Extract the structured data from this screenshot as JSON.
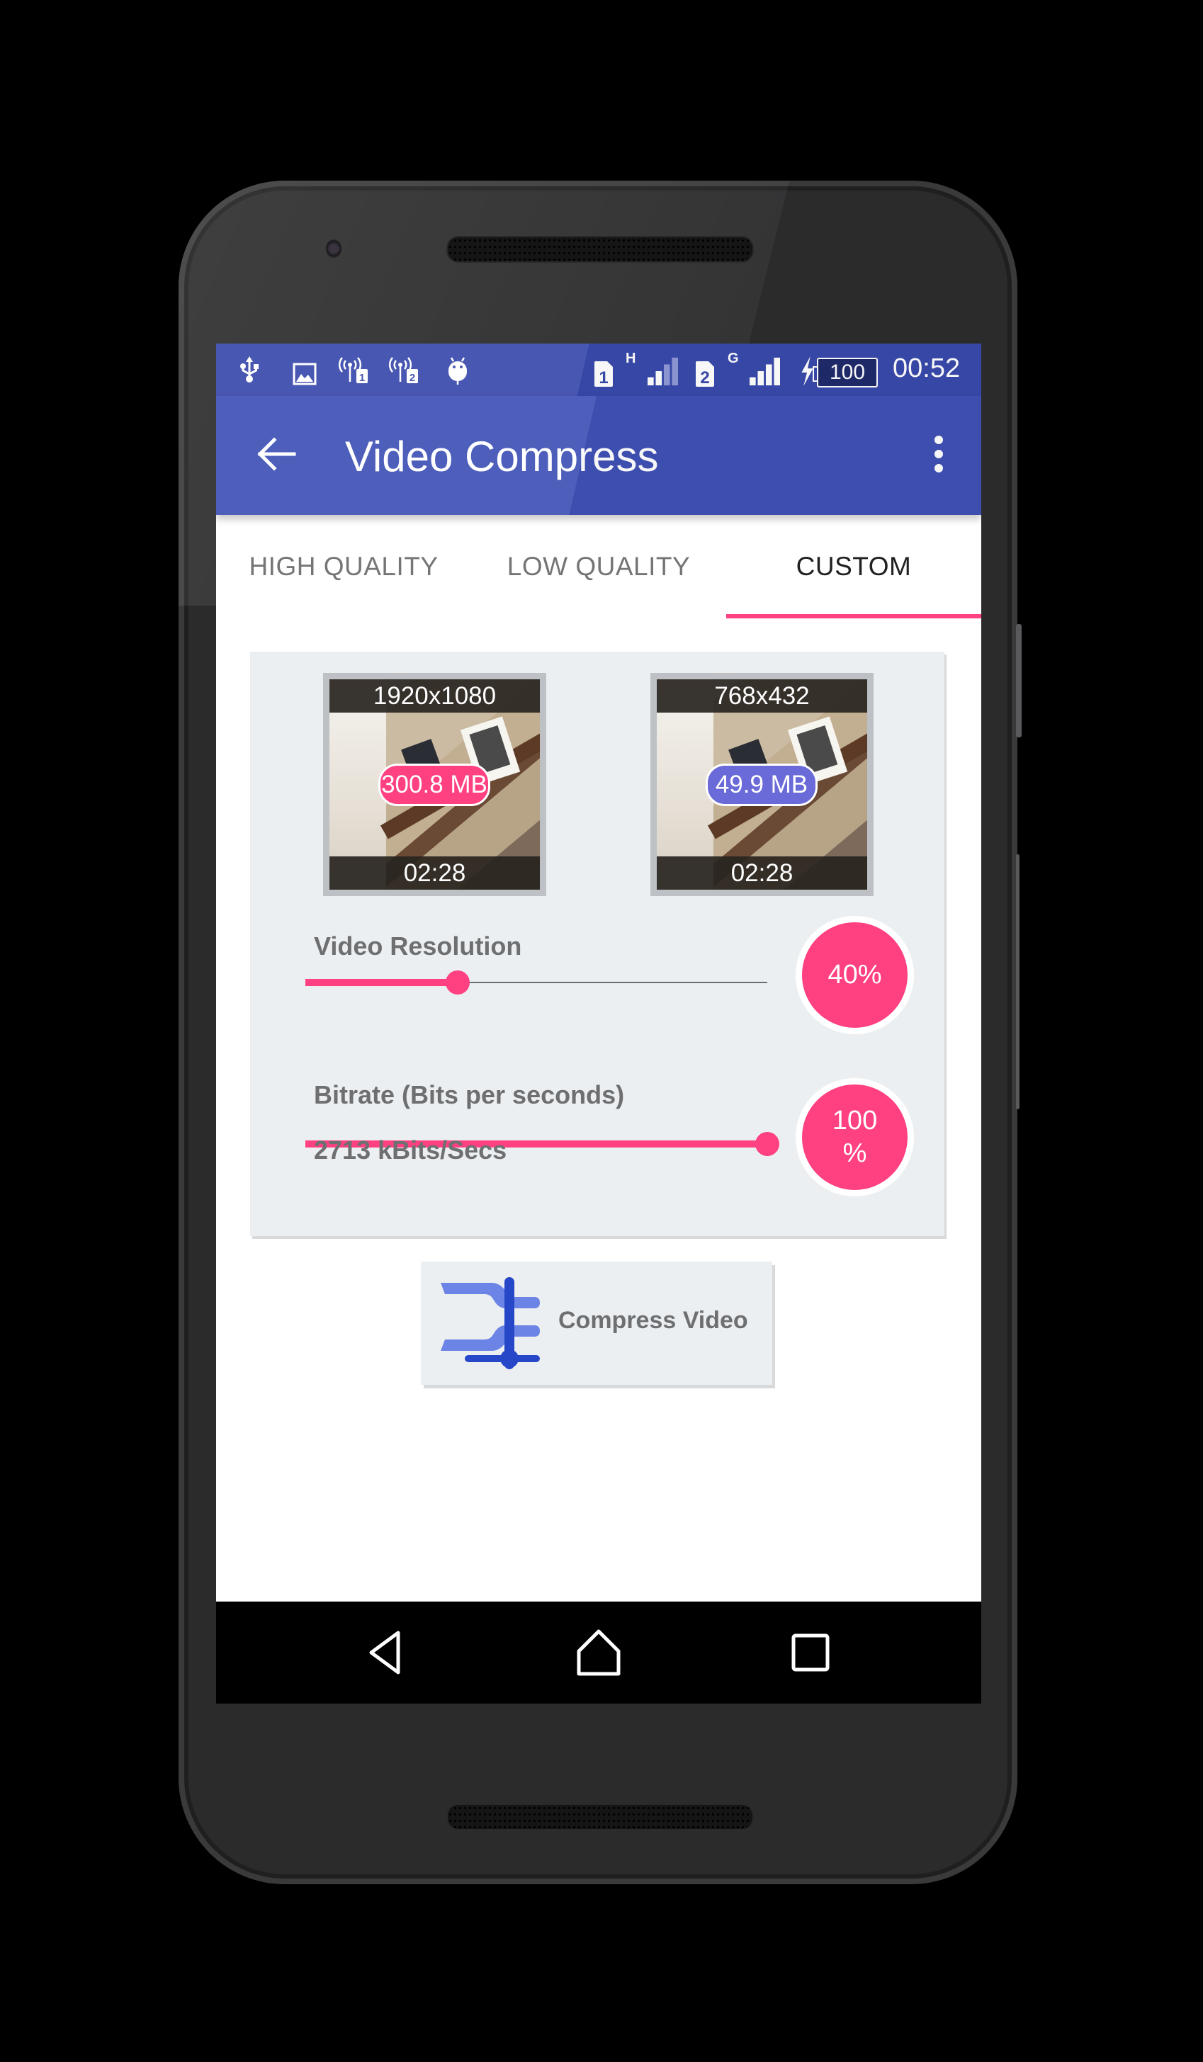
{
  "status_bar": {
    "left_icons": [
      "usb-icon",
      "image-icon",
      "hotspot-sim1-icon",
      "hotspot-sim2-icon",
      "android-debug-icon"
    ],
    "sim1": {
      "label": "1",
      "network": "H",
      "signal_bars": 2,
      "signal_max": 4
    },
    "sim2": {
      "label": "2",
      "network": "G",
      "signal_bars": 4,
      "signal_max": 4
    },
    "charging": true,
    "battery": "100",
    "time": "00:52"
  },
  "toolbar": {
    "title": "Video Compress",
    "back_icon": "arrow-left-icon",
    "menu_icon": "more-vertical-icon"
  },
  "tabs": [
    {
      "label": "HIGH QUALITY",
      "active": false
    },
    {
      "label": "LOW QUALITY",
      "active": false
    },
    {
      "label": "CUSTOM",
      "active": true
    }
  ],
  "colors": {
    "primary": "#3f51b5",
    "primary_dark": "#3949ab",
    "accent": "#ff4081",
    "output_badge": "#6a6ad8",
    "card_bg": "#eceff1"
  },
  "original_video": {
    "resolution": "1920x1080",
    "size": "300.8 MB",
    "duration": "02:28"
  },
  "output_video": {
    "resolution": "768x432",
    "size": "49.9 MB",
    "duration": "02:28"
  },
  "video_resolution": {
    "label": "Video Resolution",
    "value_percent": 40,
    "display": "40%"
  },
  "bitrate": {
    "label": "Bitrate (Bits per seconds)",
    "value_percent": 100,
    "display_number": "100",
    "display_unit": "%",
    "value_text": "2713 kBits/Secs"
  },
  "compress_button": {
    "label": "Compress Video",
    "icon": "compress-clamp-icon"
  },
  "navigation_bar": {
    "buttons": [
      "back-nav-icon",
      "home-nav-icon",
      "recents-nav-icon"
    ]
  }
}
